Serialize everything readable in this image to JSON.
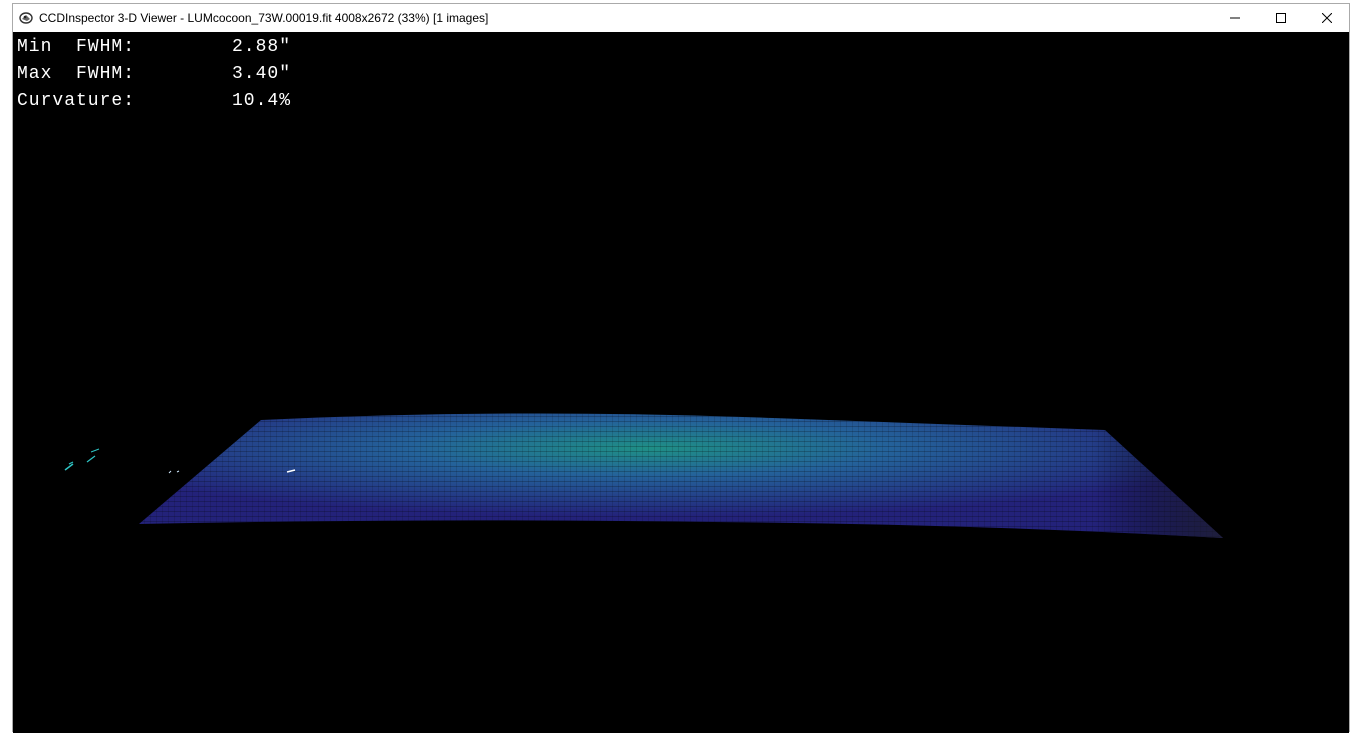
{
  "window": {
    "title": "CCDInspector 3-D Viewer - LUMcocoon_73W.00019.fit 4008x2672 (33%)  [1 images]",
    "icon": "ccdinspector-app-icon",
    "controls": {
      "minimize_icon": "minimize-icon",
      "maximize_icon": "maximize-icon",
      "close_icon": "close-icon"
    }
  },
  "stats": {
    "min_fwhm_label": "Min  FWHM:",
    "min_fwhm_value": "2.88\"",
    "max_fwhm_label": "Max  FWHM:",
    "max_fwhm_value": "3.40\"",
    "curvature_label": "Curvature:",
    "curvature_value": "10.4%"
  },
  "surface": {
    "low_color": "#23227a",
    "high_color": "#1f8f86",
    "background": "#000000"
  }
}
